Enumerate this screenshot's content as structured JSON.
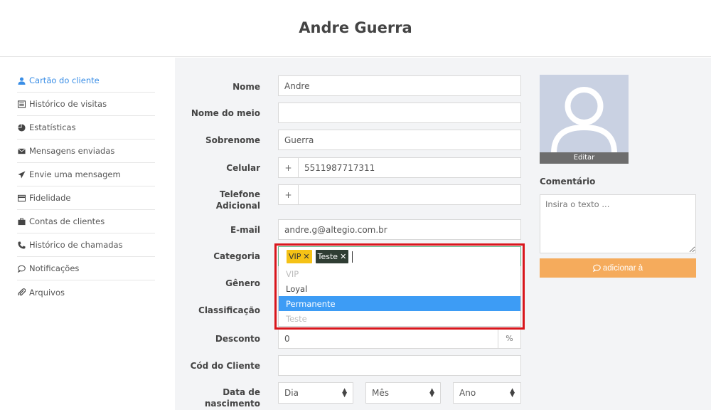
{
  "header": {
    "title": "Andre Guerra"
  },
  "sidebar": {
    "items": [
      {
        "label": "Cartão do cliente",
        "icon": "user-icon",
        "active": true
      },
      {
        "label": "Histórico de visitas",
        "icon": "list-icon"
      },
      {
        "label": "Estatísticas",
        "icon": "pie-chart-icon"
      },
      {
        "label": "Mensagens enviadas",
        "icon": "envelope-icon"
      },
      {
        "label": "Envie uma mensagem",
        "icon": "send-icon"
      },
      {
        "label": "Fidelidade",
        "icon": "card-icon"
      },
      {
        "label": "Contas de clientes",
        "icon": "briefcase-icon"
      },
      {
        "label": "Histórico de chamadas",
        "icon": "phone-icon"
      },
      {
        "label": "Notificações",
        "icon": "chat-bubble-icon"
      },
      {
        "label": "Arquivos",
        "icon": "paperclip-icon"
      }
    ]
  },
  "form": {
    "nome": {
      "label": "Nome",
      "value": "Andre"
    },
    "nome_meio": {
      "label": "Nome do meio",
      "value": ""
    },
    "sobrenome": {
      "label": "Sobrenome",
      "value": "Guerra"
    },
    "celular": {
      "label": "Celular",
      "prefix": "+",
      "value": "5511987717311"
    },
    "telefone": {
      "label_line1": "Telefone",
      "label_line2": "Adicional",
      "prefix": "+",
      "value": ""
    },
    "email": {
      "label": "E-mail",
      "value": "andre.g@altegio.com.br"
    },
    "categoria": {
      "label": "Categoria",
      "tags": [
        "VIP",
        "Teste"
      ],
      "tag_remove": "✕",
      "options": [
        {
          "label": "VIP",
          "state": "disabled"
        },
        {
          "label": "Loyal",
          "state": "normal"
        },
        {
          "label": "Permanente",
          "state": "selected"
        },
        {
          "label": "Teste",
          "state": "disabled"
        }
      ]
    },
    "genero": {
      "label": "Gênero"
    },
    "classificacao": {
      "label": "Classificação"
    },
    "desconto": {
      "label": "Desconto",
      "value": "0",
      "suffix": "%"
    },
    "cod_cliente": {
      "label": "Cód do Cliente",
      "value": ""
    },
    "nascimento": {
      "label_line1": "Data de",
      "label_line2": "nascimento",
      "dia": "Dia",
      "mes": "Mês",
      "ano": "Ano"
    }
  },
  "right": {
    "avatar_edit": "Editar",
    "comment_label": "Comentário",
    "comment_placeholder": "Insira o texto ...",
    "add_button": "adicionar à"
  },
  "colors": {
    "accent_blue": "#3a8ee6",
    "selected_option": "#3d9cf5",
    "highlight_red": "#d9161c",
    "add_button": "#f5ab5c",
    "tag_vip": "#f5c216",
    "tag_teste": "#2f3d33"
  }
}
